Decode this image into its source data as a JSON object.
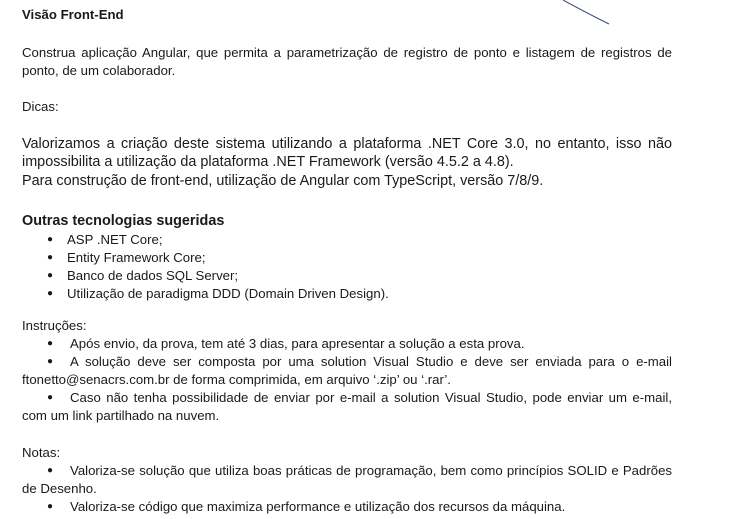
{
  "doc": {
    "title": "Visão Front-End",
    "intro": [
      "Construa aplicação Angular, que permita a parametrização de registro de ponto e listagem de registros de",
      "ponto, de um colaborador."
    ],
    "tips_label": "Dicas:",
    "tips": [
      "Valorizamos a criação deste sistema utilizando a plataforma .NET Core 3.0, no entanto, isso não",
      "impossibilita a utilização da plataforma .NET Framework (versão 4.5.2 a 4.8).",
      "Para construção de front-end, utilização de Angular com TypeScript, versão 7/8/9."
    ],
    "tech_heading": "Outras tecnologias sugeridas",
    "tech_items": [
      "ASP .NET Core;",
      "Entity Framework Core;",
      "Banco de dados SQL Server;",
      "Utilização de paradigma DDD (Domain Driven Design)."
    ],
    "instructions_label": "Instruções:",
    "instructions": [
      "Após envio, da prova, tem até 3 dias, para apresentar a solução a esta prova.",
      "A solução deve ser composta por uma solution Visual Studio e deve ser enviada para o e-mail",
      "ftonetto@senacrs.com.br de forma comprimida, em arquivo ‘.zip’ ou ‘.rar’.",
      "Caso não tenha possibilidade de enviar por e-mail a solution Visual Studio, pode enviar um e-mail,",
      "com um link partilhado na nuvem."
    ],
    "notes_label": "Notas:",
    "notes": [
      "Valoriza-se solução que utiliza boas práticas de programação, bem como princípios SOLID e Padrões",
      "de Desenho.",
      "Valoriza-se código que maximiza performance e utilização dos recursos da máquina."
    ],
    "bullet": "●"
  }
}
